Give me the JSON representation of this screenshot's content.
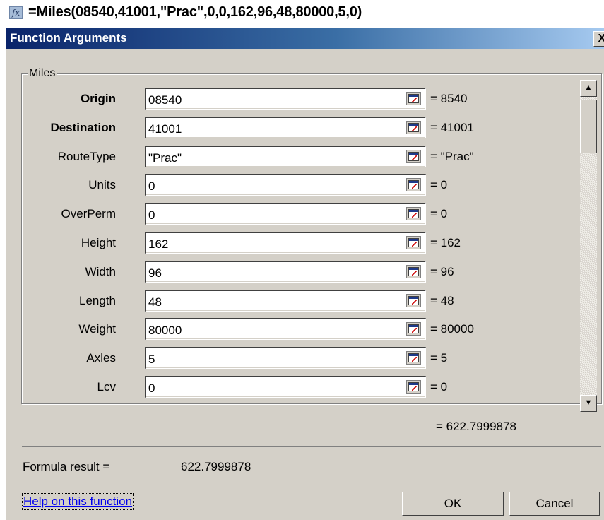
{
  "formula_bar": {
    "fx_icon": "fx-icon",
    "fx_label": "fx",
    "formula": "=Miles(08540,41001,\"Prac\",0,0,162,96,48,80000,5,0)"
  },
  "dialog": {
    "title": "Function Arguments",
    "close_label": "X",
    "function_name": "Miles",
    "arguments": [
      {
        "label": "Origin",
        "bold": true,
        "input": "08540",
        "value": "= 8540"
      },
      {
        "label": "Destination",
        "bold": true,
        "input": "41001",
        "value": "= 41001"
      },
      {
        "label": "RouteType",
        "bold": false,
        "input": "\"Prac\"",
        "value": "= \"Prac\""
      },
      {
        "label": "Units",
        "bold": false,
        "input": "0",
        "value": "= 0"
      },
      {
        "label": "OverPerm",
        "bold": false,
        "input": "0",
        "value": "= 0"
      },
      {
        "label": "Height",
        "bold": false,
        "input": "162",
        "value": "= 162"
      },
      {
        "label": "Width",
        "bold": false,
        "input": "96",
        "value": "= 96"
      },
      {
        "label": "Length",
        "bold": false,
        "input": "48",
        "value": "= 48"
      },
      {
        "label": "Weight",
        "bold": false,
        "input": "80000",
        "value": "= 80000"
      },
      {
        "label": "Axles",
        "bold": false,
        "input": "5",
        "value": "= 5"
      },
      {
        "label": "Lcv",
        "bold": false,
        "input": "0",
        "value": "= 0"
      }
    ],
    "result_equals": "= 622.7999878",
    "formula_result_label": "Formula result =",
    "formula_result_value": "622.7999878",
    "help_link": "Help on this function",
    "ok_label": "OK",
    "cancel_label": "Cancel",
    "scroll_up": "▲",
    "scroll_down": "▼"
  }
}
